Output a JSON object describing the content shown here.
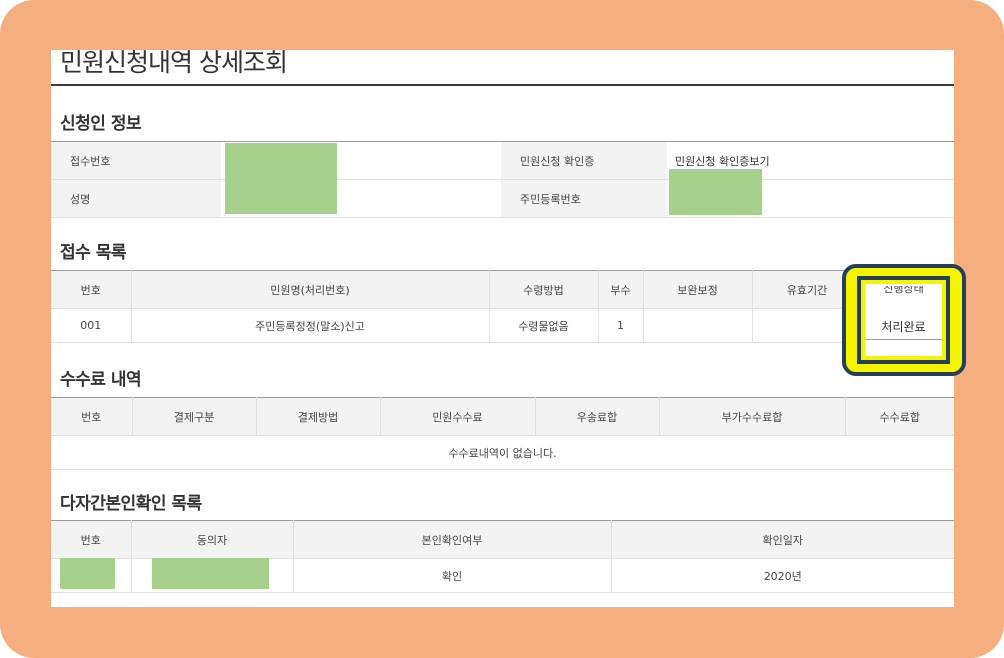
{
  "page": {
    "title": "민원신청내역 상세조회",
    "colors": {
      "frame": "#f4ae7f",
      "highlight": "#f5f500",
      "highlight_border": "#25405a",
      "redaction": "#a8d08d"
    }
  },
  "applicant": {
    "section_title": "신청인 정보",
    "receipt_number_label": "접수번호",
    "certificate_label": "민원신청 확인증",
    "certificate_link": "민원신청 확인증보기",
    "name_label": "성명",
    "resident_number_label": "주민등록번호"
  },
  "receipts": {
    "section_title": "접수 목록",
    "headers": [
      "번호",
      "민원명(처리번호)",
      "수령방법",
      "부수",
      "보완보정",
      "유효기간",
      "진행상태"
    ],
    "rows": [
      {
        "no": "001",
        "name": "주민등록정정(말소)신고",
        "method": "수령물없음",
        "copies": "1",
        "supplement": "",
        "validity": "",
        "status": "처리완료"
      }
    ]
  },
  "fees": {
    "section_title": "수수료 내역",
    "headers": [
      "번호",
      "결제구분",
      "결제방법",
      "민원수수료",
      "우송료합",
      "부가수수료합",
      "수수료합"
    ],
    "empty_message": "수수료내역이 없습니다."
  },
  "identity": {
    "section_title": "다자간본인확인 목록",
    "headers": [
      "번호",
      "동의자",
      "본인확인여부",
      "확인일자"
    ],
    "rows": [
      {
        "confirmed": "확인",
        "date": "2020년"
      }
    ]
  }
}
